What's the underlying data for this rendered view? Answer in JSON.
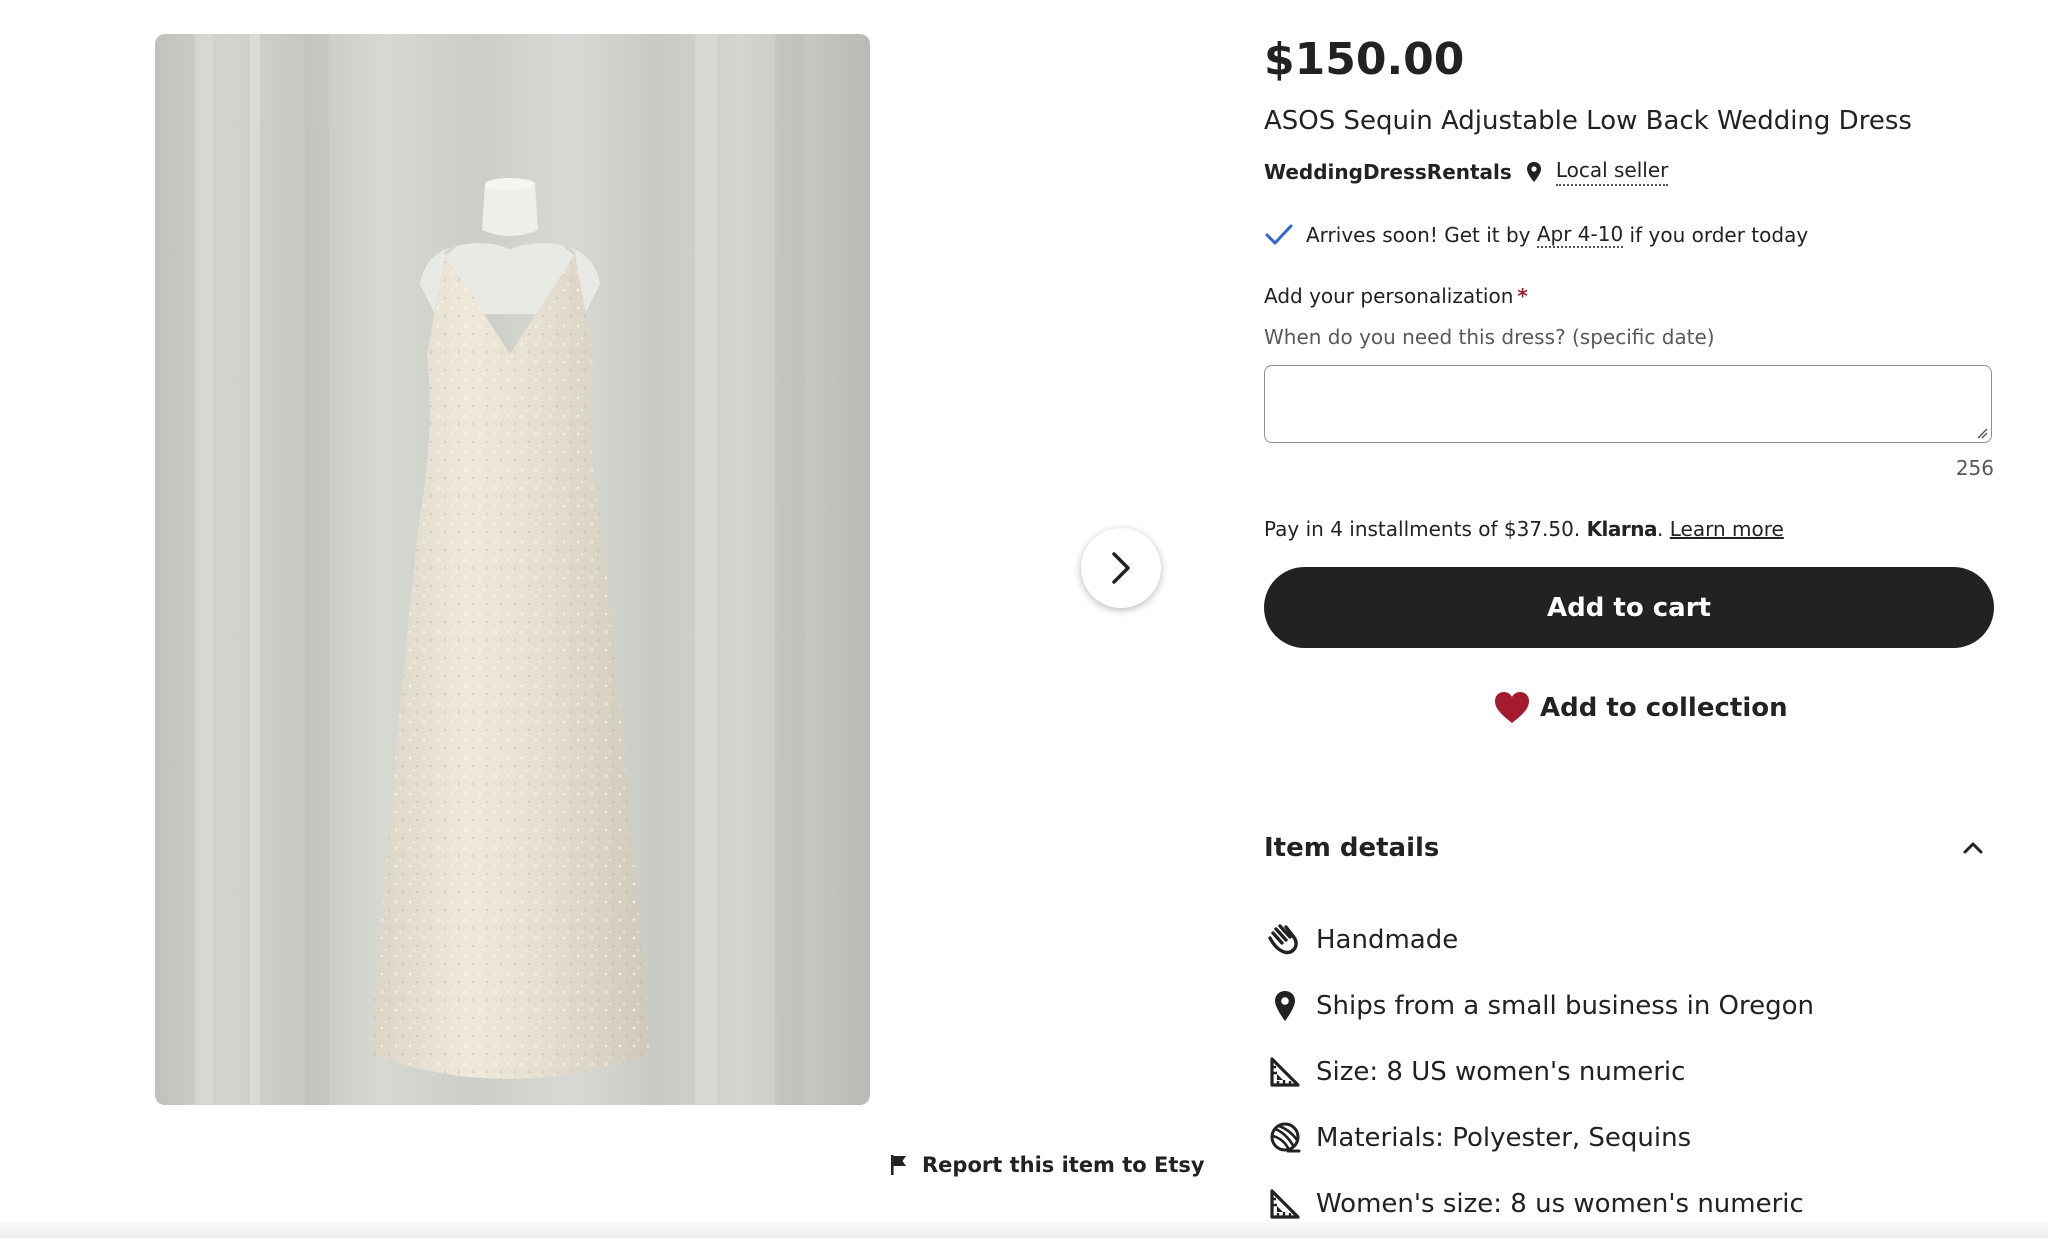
{
  "gallery": {
    "image_alt": "",
    "report_label": "Report this item to Etsy"
  },
  "listing": {
    "price": "$150.00",
    "title": "ASOS Sequin Adjustable Low Back Wedding Dress",
    "seller_name": "WeddingDressRentals",
    "local_seller_label": "Local seller"
  },
  "delivery": {
    "prefix": "Arrives soon! Get it by ",
    "dates": "Apr 4-10",
    "suffix": " if you order today"
  },
  "personalization": {
    "label": "Add your personalization",
    "required_marker": "*",
    "hint": "When do you need this dress? (specific date)",
    "value": "",
    "char_count": "256"
  },
  "payment": {
    "installment_text": "Pay in 4 installments of $37.50.",
    "klarna_logo": "Klarna",
    "period": ".",
    "learn_more": "Learn more"
  },
  "actions": {
    "add_to_cart": "Add to cart",
    "add_to_collection": "Add to collection"
  },
  "item_details": {
    "title": "Item details",
    "items": [
      {
        "icon": "hand-icon",
        "text": "Handmade"
      },
      {
        "icon": "location-pin-icon",
        "text": "Ships from a small business in Oregon"
      },
      {
        "icon": "ruler-icon",
        "text": "Size: 8 US women's numeric"
      },
      {
        "icon": "yarn-icon",
        "text": "Materials: Polyester, Sequins"
      },
      {
        "icon": "ruler-icon",
        "text": "Women's size: 8 us women's numeric"
      }
    ]
  },
  "colors": {
    "primary_button": "#222222",
    "heart": "#a61a2e",
    "check": "#2f66d0",
    "required": "#a61a2e"
  }
}
